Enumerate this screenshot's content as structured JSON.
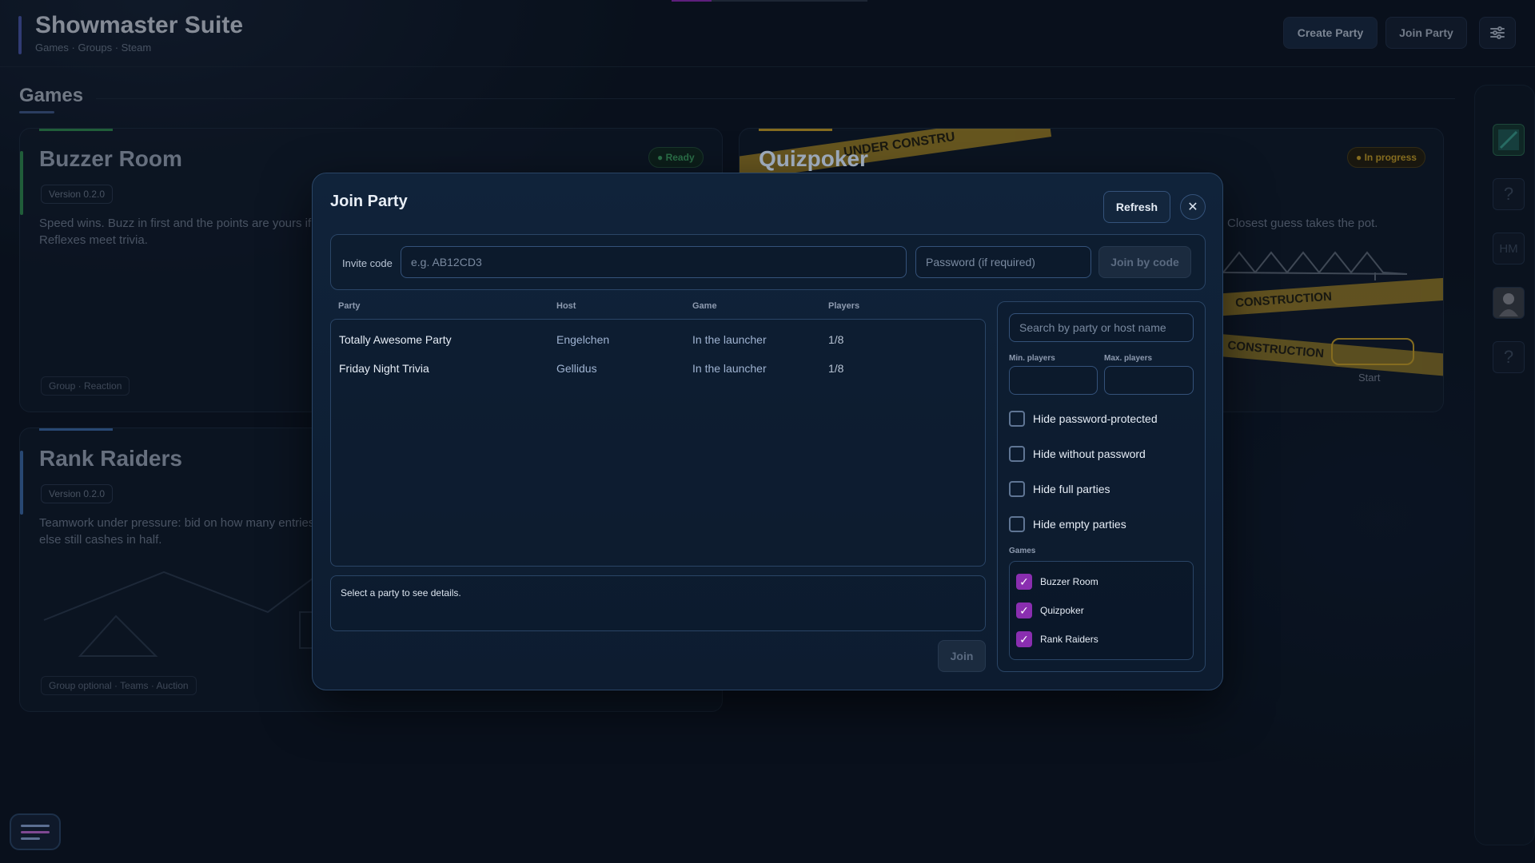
{
  "app": {
    "title": "Showmaster Suite",
    "subtitle": "Games · Groups · Steam",
    "create_party": "Create Party",
    "join_party": "Join Party"
  },
  "section": {
    "title": "Games"
  },
  "cards": [
    {
      "title": "Buzzer Room",
      "version": "Version 0.2.0",
      "status": "Ready",
      "description_1": "Speed wins. Buzz in first and the points are yours if",
      "description_2": "Reflexes meet trivia.",
      "tags": "Group · Reaction",
      "accent": "#2e8a4f"
    },
    {
      "title": "Quizpoker",
      "status": "In progress",
      "description_tail": "Closest guess takes the pot.",
      "banner_1": "UNDER CONSTRU",
      "banner_2": "CONSTRUCTION",
      "banner_3": "CONSTRUCTION",
      "start_label": "Start",
      "accent": "#c9a227"
    },
    {
      "title": "Rank Raiders",
      "version": "Version 0.2.0",
      "description_1": "Teamwork under pressure: bid on how many entries",
      "description_2": "else still cashes in half.",
      "tags": "Group optional · Teams · Auction",
      "accent": "#3b6aa8"
    }
  ],
  "rail": {
    "help_glyph": "?",
    "initials": "HM"
  },
  "modal": {
    "title": "Join Party",
    "refresh": "Refresh",
    "close_glyph": "✕",
    "invite_label": "Invite code",
    "invite_placeholder": "e.g. AB12CD3",
    "password_placeholder": "Password (if required)",
    "join_by_code": "Join by code",
    "columns": {
      "party": "Party",
      "host": "Host",
      "game": "Game",
      "players": "Players"
    },
    "rows": [
      {
        "party": "Totally Awesome Party",
        "host": "Engelchen",
        "game": "In the launcher",
        "players": "1/8"
      },
      {
        "party": "Friday Night Trivia",
        "host": "Gellidus",
        "game": "In the launcher",
        "players": "1/8"
      }
    ],
    "details": "Select a party to see details.",
    "join": "Join",
    "filters": {
      "search_placeholder": "Search by party or host name",
      "min_players": "Min. players",
      "max_players": "Max. players",
      "hide_password": "Hide password-protected",
      "hide_no_password": "Hide without password",
      "hide_full": "Hide full parties",
      "hide_empty": "Hide empty parties",
      "games_label": "Games",
      "games": [
        "Buzzer Room",
        "Quizpoker",
        "Rank Raiders"
      ],
      "check_glyph": "✓"
    }
  },
  "colors": {
    "accent_purple": "#8a2eb0",
    "ready_green": "#3fa866",
    "progress_gold": "#c9a227"
  }
}
